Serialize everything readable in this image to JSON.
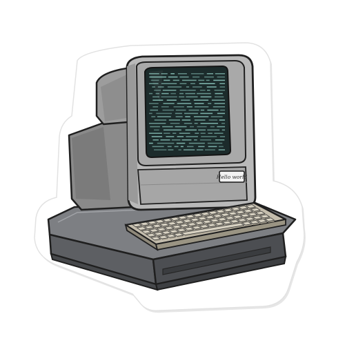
{
  "image": {
    "subject": "retro-computer-sticker",
    "label_text": "Hello world",
    "colors": {
      "background": "#ffffff",
      "sticker_border": "#ffffff",
      "sticker_shadow": "#d9d9d9",
      "outline": "#1f1f1f",
      "body_light": "#bcbcbc",
      "body_mid": "#9a9a9a",
      "body_dark": "#707070",
      "base_top": "#7d7f83",
      "base_front": "#5d5f63",
      "base_dark": "#45474a",
      "screen_bg": "#1c2b2b",
      "screen_text": "#7fb5ad",
      "keycap": "#d8d2c2",
      "keycap_shadow": "#a69f8e",
      "label_bg": "#f2f2f2"
    }
  }
}
